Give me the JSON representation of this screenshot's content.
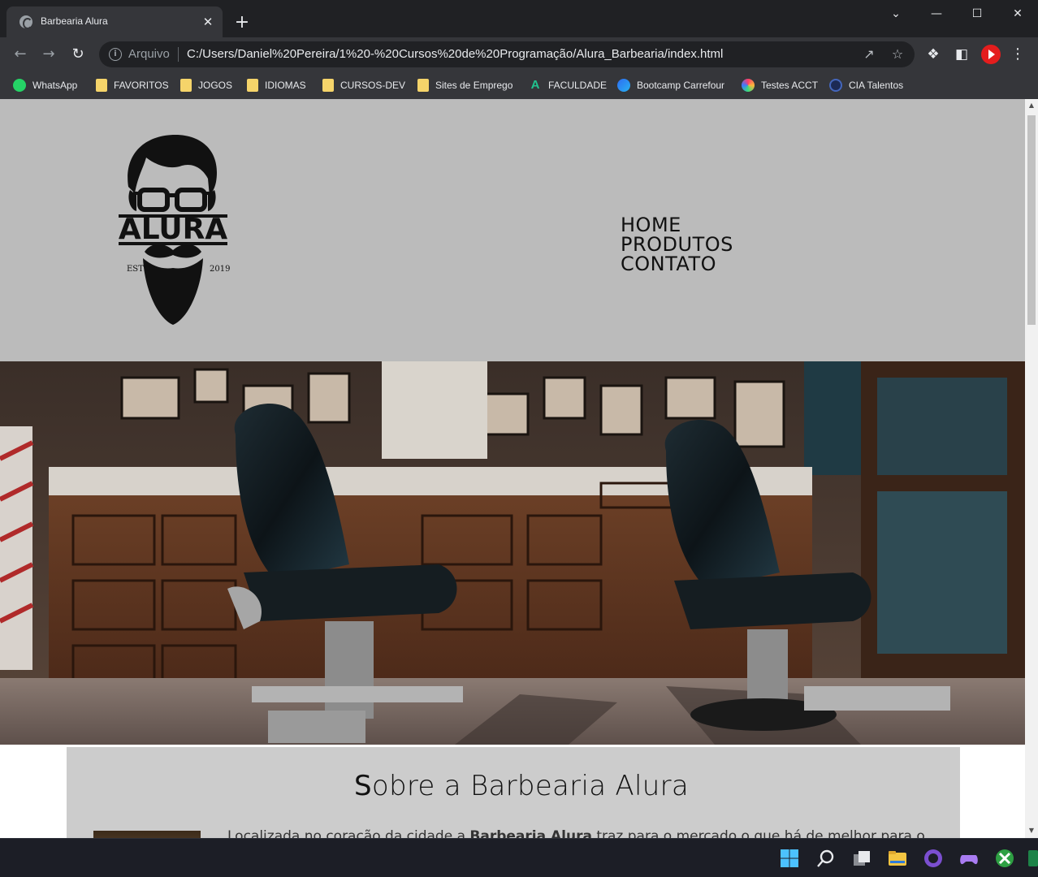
{
  "browser": {
    "tab_title": "Barbearia Alura",
    "tab_close": "✕",
    "new_tab": "+",
    "window_controls": {
      "minimize": "—",
      "maximize": "☐",
      "close": "✕",
      "tab_search": "⌄"
    },
    "omnibox": {
      "label": "Arquivo",
      "url": "C:/Users/Daniel%20Pereira/1%20-%20Cursos%20de%20Programação/Alura_Barbearia/index.html"
    },
    "bookmarks": [
      {
        "label": "WhatsApp",
        "icon": "whatsapp-icon"
      },
      {
        "label": "FAVORITOS",
        "icon": "folder-icon"
      },
      {
        "label": "JOGOS",
        "icon": "folder-icon"
      },
      {
        "label": "IDIOMAS",
        "icon": "folder-icon"
      },
      {
        "label": "CURSOS-DEV",
        "icon": "folder-icon"
      },
      {
        "label": "Sites de Emprego",
        "icon": "folder-icon"
      },
      {
        "label": "FACULDADE",
        "icon": "faculdade-icon"
      },
      {
        "label": "Bootcamp Carrefour",
        "icon": "bootcamp-icon"
      },
      {
        "label": "Testes ACCT",
        "icon": "acct-icon"
      },
      {
        "label": "CIA Talentos",
        "icon": "cia-icon"
      }
    ]
  },
  "site": {
    "logo": {
      "name": "ALURA",
      "estd": "ESTD",
      "year": "2019"
    },
    "nav": [
      "HOME",
      "PRODUTOS",
      "CONTATO"
    ],
    "about": {
      "title_initial": "S",
      "title_rest": "obre a Barbearia Alura",
      "text_before": "Localizada no coração da cidade a ",
      "text_bold": "Barbearia Alura",
      "text_after": " traz para o mercado o que há de melhor para o"
    }
  },
  "colors": {
    "header_bg": "#bbbbbb",
    "about_bg": "#cccccc",
    "chrome_dark": "#202124",
    "chrome_toolbar": "#35363a"
  }
}
